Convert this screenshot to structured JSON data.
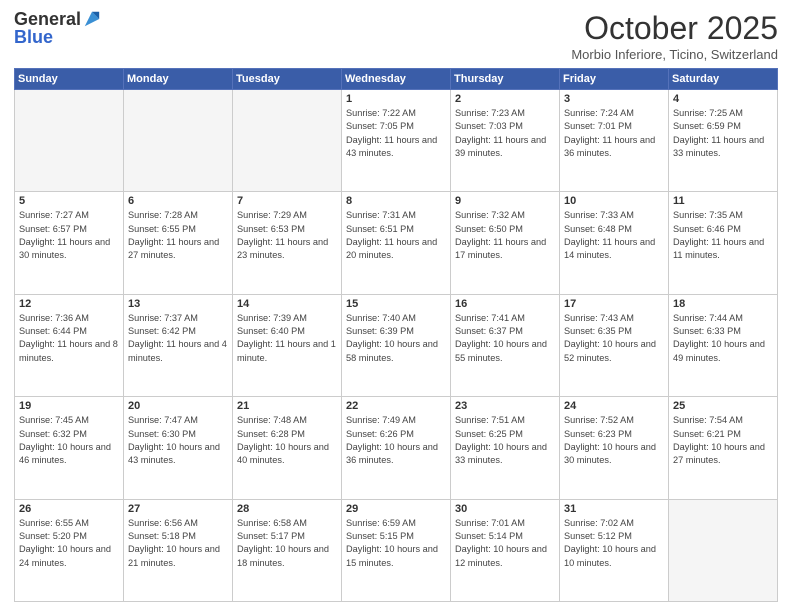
{
  "logo": {
    "general": "General",
    "blue": "Blue"
  },
  "title": "October 2025",
  "location": "Morbio Inferiore, Ticino, Switzerland",
  "days_of_week": [
    "Sunday",
    "Monday",
    "Tuesday",
    "Wednesday",
    "Thursday",
    "Friday",
    "Saturday"
  ],
  "weeks": [
    [
      {
        "day": "",
        "info": ""
      },
      {
        "day": "",
        "info": ""
      },
      {
        "day": "",
        "info": ""
      },
      {
        "day": "1",
        "info": "Sunrise: 7:22 AM\nSunset: 7:05 PM\nDaylight: 11 hours and 43 minutes."
      },
      {
        "day": "2",
        "info": "Sunrise: 7:23 AM\nSunset: 7:03 PM\nDaylight: 11 hours and 39 minutes."
      },
      {
        "day": "3",
        "info": "Sunrise: 7:24 AM\nSunset: 7:01 PM\nDaylight: 11 hours and 36 minutes."
      },
      {
        "day": "4",
        "info": "Sunrise: 7:25 AM\nSunset: 6:59 PM\nDaylight: 11 hours and 33 minutes."
      }
    ],
    [
      {
        "day": "5",
        "info": "Sunrise: 7:27 AM\nSunset: 6:57 PM\nDaylight: 11 hours and 30 minutes."
      },
      {
        "day": "6",
        "info": "Sunrise: 7:28 AM\nSunset: 6:55 PM\nDaylight: 11 hours and 27 minutes."
      },
      {
        "day": "7",
        "info": "Sunrise: 7:29 AM\nSunset: 6:53 PM\nDaylight: 11 hours and 23 minutes."
      },
      {
        "day": "8",
        "info": "Sunrise: 7:31 AM\nSunset: 6:51 PM\nDaylight: 11 hours and 20 minutes."
      },
      {
        "day": "9",
        "info": "Sunrise: 7:32 AM\nSunset: 6:50 PM\nDaylight: 11 hours and 17 minutes."
      },
      {
        "day": "10",
        "info": "Sunrise: 7:33 AM\nSunset: 6:48 PM\nDaylight: 11 hours and 14 minutes."
      },
      {
        "day": "11",
        "info": "Sunrise: 7:35 AM\nSunset: 6:46 PM\nDaylight: 11 hours and 11 minutes."
      }
    ],
    [
      {
        "day": "12",
        "info": "Sunrise: 7:36 AM\nSunset: 6:44 PM\nDaylight: 11 hours and 8 minutes."
      },
      {
        "day": "13",
        "info": "Sunrise: 7:37 AM\nSunset: 6:42 PM\nDaylight: 11 hours and 4 minutes."
      },
      {
        "day": "14",
        "info": "Sunrise: 7:39 AM\nSunset: 6:40 PM\nDaylight: 11 hours and 1 minute."
      },
      {
        "day": "15",
        "info": "Sunrise: 7:40 AM\nSunset: 6:39 PM\nDaylight: 10 hours and 58 minutes."
      },
      {
        "day": "16",
        "info": "Sunrise: 7:41 AM\nSunset: 6:37 PM\nDaylight: 10 hours and 55 minutes."
      },
      {
        "day": "17",
        "info": "Sunrise: 7:43 AM\nSunset: 6:35 PM\nDaylight: 10 hours and 52 minutes."
      },
      {
        "day": "18",
        "info": "Sunrise: 7:44 AM\nSunset: 6:33 PM\nDaylight: 10 hours and 49 minutes."
      }
    ],
    [
      {
        "day": "19",
        "info": "Sunrise: 7:45 AM\nSunset: 6:32 PM\nDaylight: 10 hours and 46 minutes."
      },
      {
        "day": "20",
        "info": "Sunrise: 7:47 AM\nSunset: 6:30 PM\nDaylight: 10 hours and 43 minutes."
      },
      {
        "day": "21",
        "info": "Sunrise: 7:48 AM\nSunset: 6:28 PM\nDaylight: 10 hours and 40 minutes."
      },
      {
        "day": "22",
        "info": "Sunrise: 7:49 AM\nSunset: 6:26 PM\nDaylight: 10 hours and 36 minutes."
      },
      {
        "day": "23",
        "info": "Sunrise: 7:51 AM\nSunset: 6:25 PM\nDaylight: 10 hours and 33 minutes."
      },
      {
        "day": "24",
        "info": "Sunrise: 7:52 AM\nSunset: 6:23 PM\nDaylight: 10 hours and 30 minutes."
      },
      {
        "day": "25",
        "info": "Sunrise: 7:54 AM\nSunset: 6:21 PM\nDaylight: 10 hours and 27 minutes."
      }
    ],
    [
      {
        "day": "26",
        "info": "Sunrise: 6:55 AM\nSunset: 5:20 PM\nDaylight: 10 hours and 24 minutes."
      },
      {
        "day": "27",
        "info": "Sunrise: 6:56 AM\nSunset: 5:18 PM\nDaylight: 10 hours and 21 minutes."
      },
      {
        "day": "28",
        "info": "Sunrise: 6:58 AM\nSunset: 5:17 PM\nDaylight: 10 hours and 18 minutes."
      },
      {
        "day": "29",
        "info": "Sunrise: 6:59 AM\nSunset: 5:15 PM\nDaylight: 10 hours and 15 minutes."
      },
      {
        "day": "30",
        "info": "Sunrise: 7:01 AM\nSunset: 5:14 PM\nDaylight: 10 hours and 12 minutes."
      },
      {
        "day": "31",
        "info": "Sunrise: 7:02 AM\nSunset: 5:12 PM\nDaylight: 10 hours and 10 minutes."
      },
      {
        "day": "",
        "info": ""
      }
    ]
  ]
}
